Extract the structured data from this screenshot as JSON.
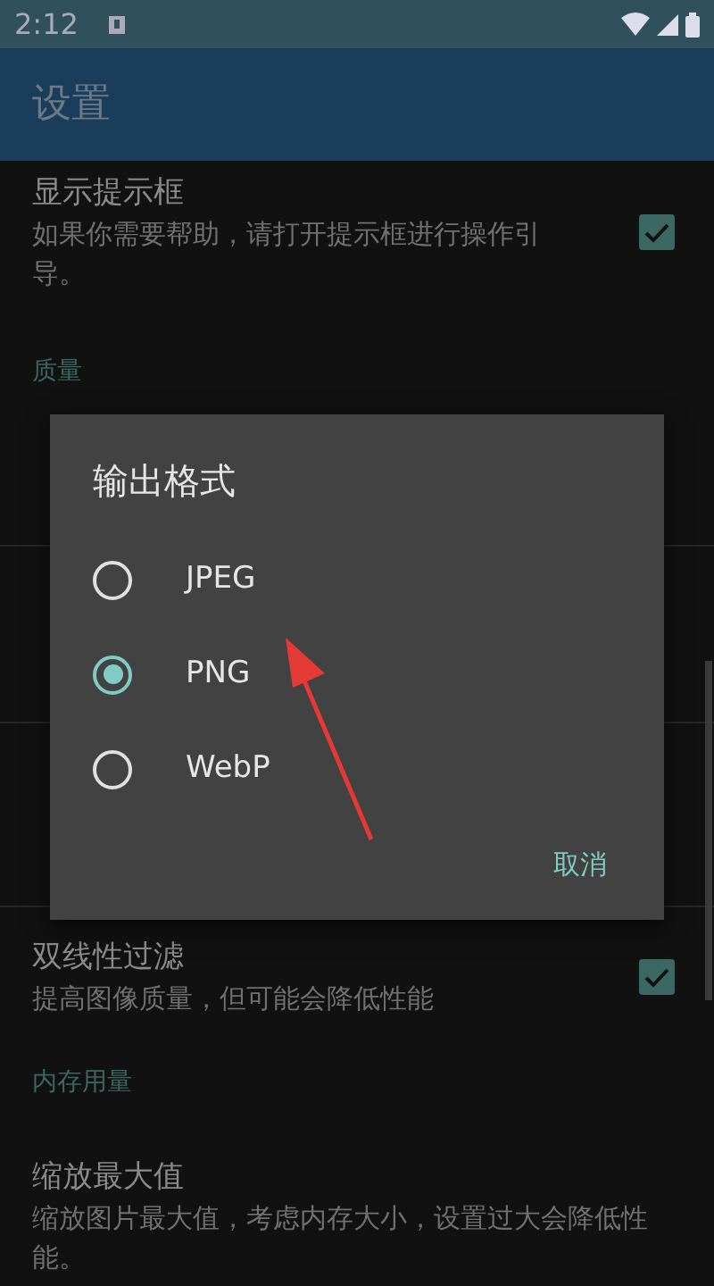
{
  "status_bar": {
    "time": "2:12"
  },
  "app_bar": {
    "title": "设置"
  },
  "settings": [
    {
      "kind": "item",
      "title": "显示提示框",
      "summary": "如果你需要帮助，请打开提示框进行操作引导。",
      "checked": true
    },
    {
      "kind": "category",
      "title": "质量"
    },
    {
      "kind": "covered"
    },
    {
      "kind": "covered"
    },
    {
      "kind": "covered"
    },
    {
      "kind": "item",
      "title": "双线性过滤",
      "summary": "提高图像质量，但可能会降低性能",
      "checked": true
    },
    {
      "kind": "category",
      "title": "内存用量"
    },
    {
      "kind": "item",
      "title": "缩放最大值",
      "summary": "缩放图片最大值，考虑内存大小，设置过大会降低性能。"
    }
  ],
  "dialog": {
    "title": "输出格式",
    "options": [
      {
        "label": "JPEG",
        "selected": false
      },
      {
        "label": "PNG",
        "selected": true
      },
      {
        "label": "WebP",
        "selected": false
      }
    ],
    "cancel": "取消"
  }
}
